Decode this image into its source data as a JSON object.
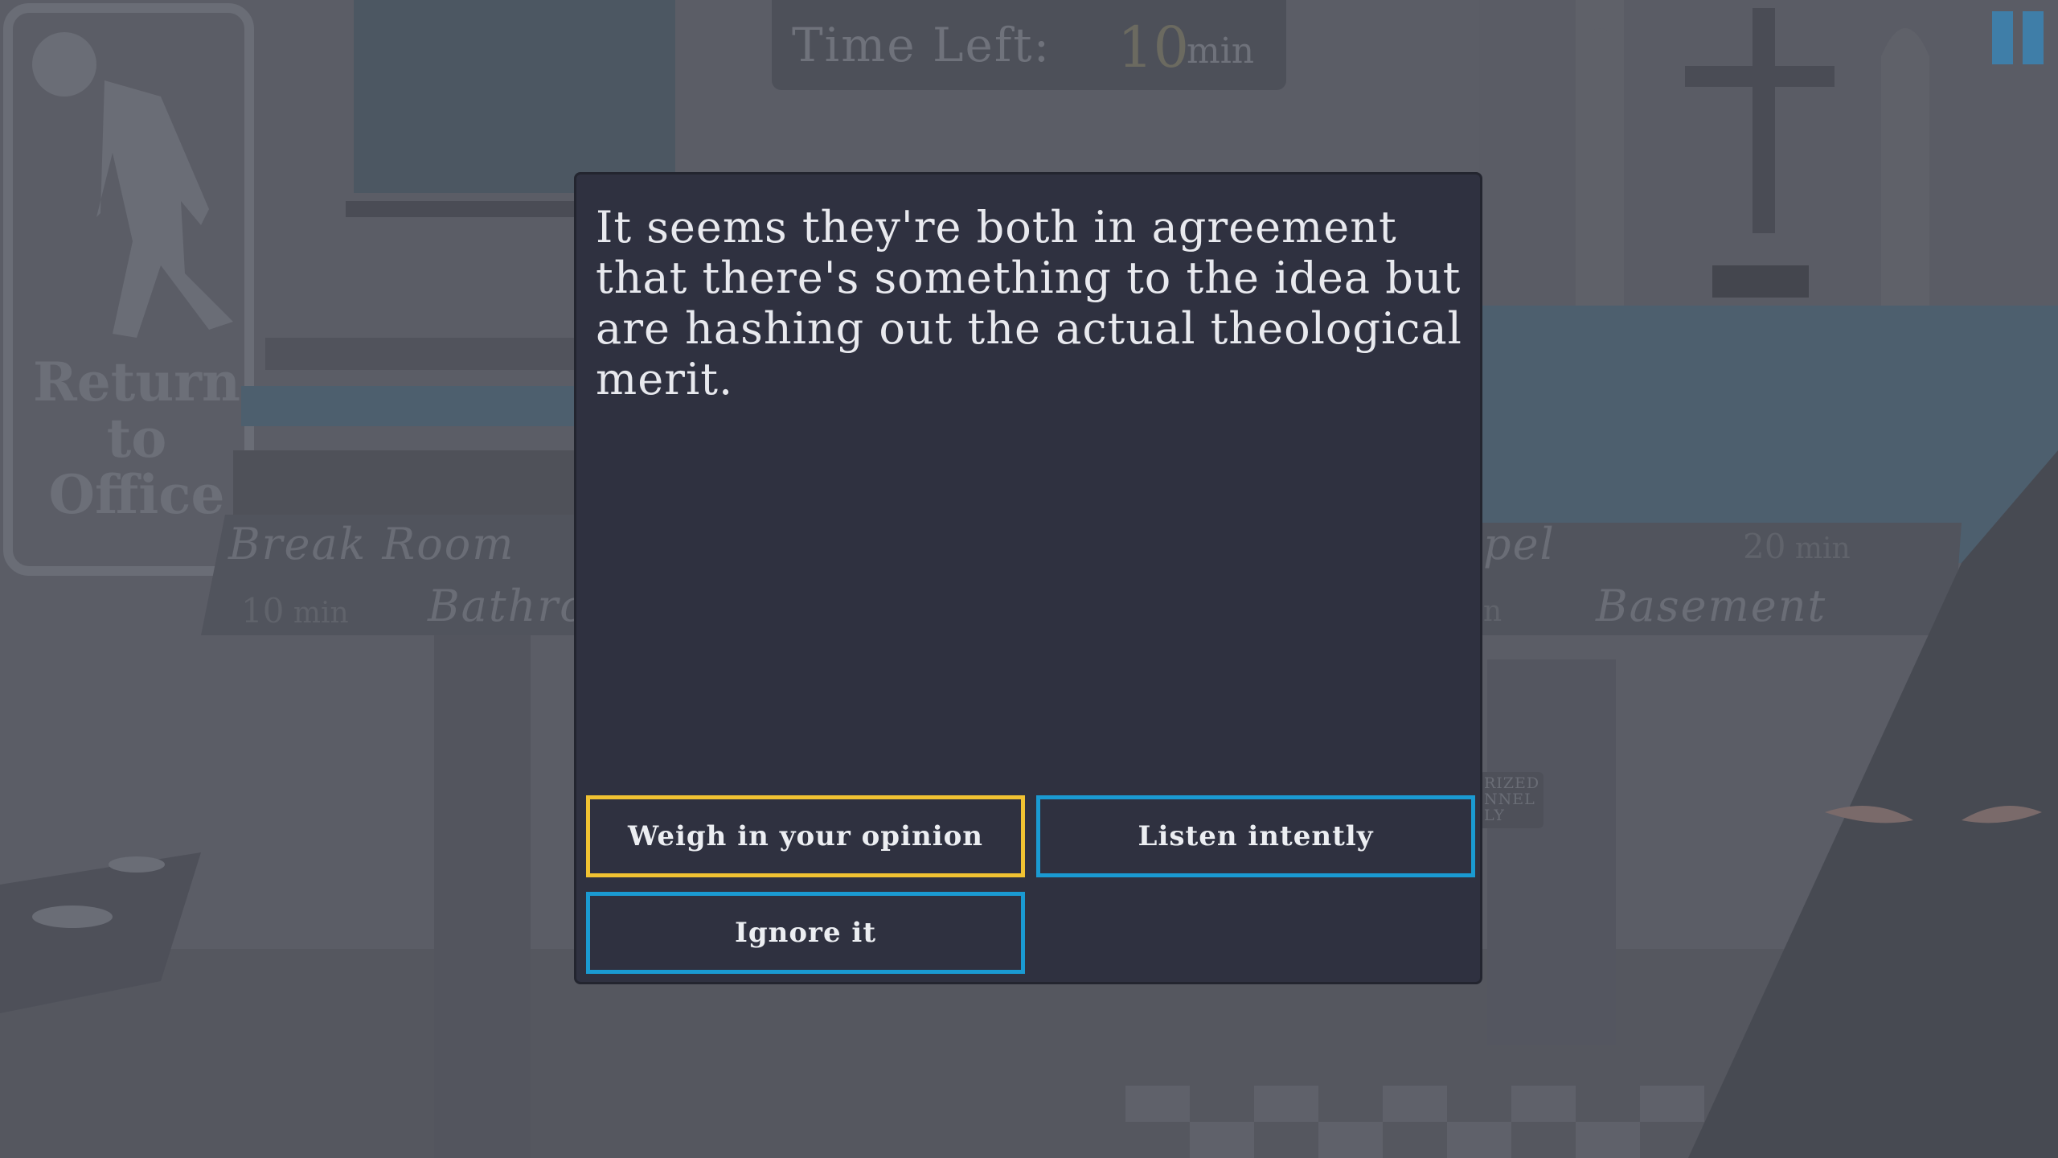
{
  "hud": {
    "time_label": "Time Left:",
    "time_value": "10",
    "time_unit": "min",
    "pause_icon": "pause-icon"
  },
  "background": {
    "exit_sign": {
      "icon": "walking-person-icon",
      "line1": "Return",
      "line2": "to",
      "line3": "Office"
    },
    "locations": [
      {
        "name": "Break Room",
        "time_value": "",
        "time_unit": ""
      },
      {
        "name": "Bathro",
        "time_value": "10",
        "time_unit": "min"
      },
      {
        "name": "pel",
        "time_value": "20",
        "time_unit": "min"
      },
      {
        "name": "Basement",
        "time_value": "",
        "time_unit": "n"
      }
    ],
    "door_sign": [
      "RIZED",
      "NNEL",
      "LY"
    ]
  },
  "dialog": {
    "text": "It seems they're both in agreement that there's something to the idea but are hashing out the actual theological merit.",
    "choices": [
      {
        "label": "Weigh in your opinion",
        "selected": true
      },
      {
        "label": "Listen intently",
        "selected": false
      },
      {
        "label": "Ignore it",
        "selected": false
      }
    ]
  },
  "colors": {
    "dialog_bg": "#2f3140",
    "choice_border": "#1a9ad2",
    "choice_selected_border": "#f1c232",
    "pause": "#3f7ea8"
  }
}
